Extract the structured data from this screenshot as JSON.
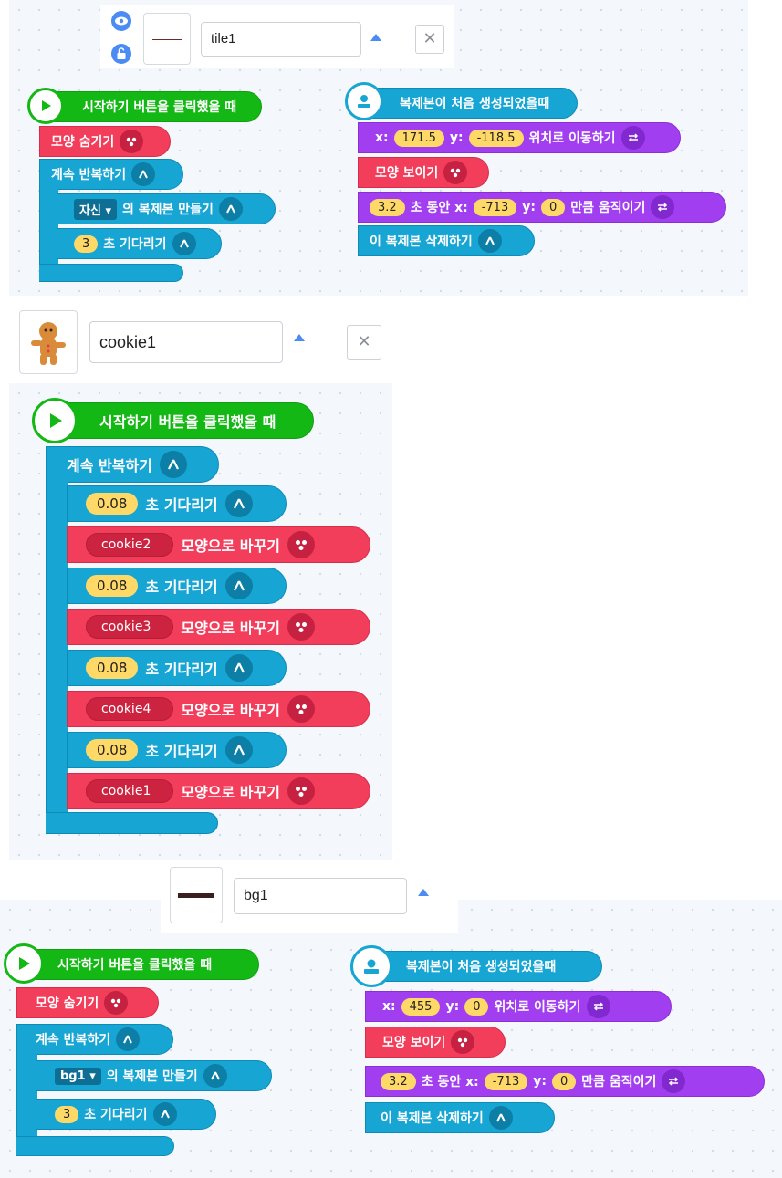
{
  "colors": {
    "cyan": "#17a5d3",
    "red": "#f23d5b",
    "purple": "#a13ef0",
    "green": "#14b814",
    "value": "#ffd968",
    "accent": "#4a8cf4"
  },
  "icons": {
    "eye": "eye-icon",
    "lock": "lock-icon",
    "close": "close-icon",
    "play": "play-icon",
    "user": "user-icon",
    "flow": "flow-icon",
    "shape": "shape-icon",
    "move": "move-icon"
  },
  "objects": [
    {
      "name": "tile1",
      "close": "✕"
    },
    {
      "name": "cookie1",
      "close": "✕"
    },
    {
      "name": "bg1"
    }
  ],
  "tile1": {
    "start": "시작하기 버튼을 클릭했을 때",
    "hide": "모양 숨기기",
    "loop": "계속 반복하기",
    "clone_target": "자신",
    "clone_label": "의 복제본 만들기",
    "wait_val": "3",
    "wait_label": "초 기다리기",
    "clone_start": "복제본이 처음 생성되었을때",
    "x_label": "x:",
    "x_val": "171.5",
    "y_label": "y:",
    "y_val": "-118.5",
    "move_to": "위치로 이동하기",
    "show": "모양 보이기",
    "dur": "3.2",
    "dur_label": "초 동안 x:",
    "dx": "-713",
    "dy_label": "y:",
    "dy": "0",
    "move_by": "만큼 움직이기",
    "delete": "이 복제본 삭제하기"
  },
  "cookie1": {
    "start": "시작하기 버튼을 클릭했을 때",
    "loop": "계속 반복하기",
    "wait_label": "초 기다리기",
    "change_label": "모양으로 바꾸기",
    "steps": [
      {
        "wait": "0.08",
        "shape": "cookie2"
      },
      {
        "wait": "0.08",
        "shape": "cookie3"
      },
      {
        "wait": "0.08",
        "shape": "cookie4"
      },
      {
        "wait": "0.08",
        "shape": "cookie1"
      }
    ]
  },
  "bg1": {
    "start": "시작하기 버튼을 클릭했을 때",
    "hide": "모양 숨기기",
    "loop": "계속 반복하기",
    "clone_target": "bg1",
    "clone_label": "의 복제본 만들기",
    "wait_val": "3",
    "wait_label": "초 기다리기",
    "clone_start": "복제본이 처음 생성되었을때",
    "x_label": "x:",
    "x_val": "455",
    "y_label": "y:",
    "y_val": "0",
    "move_to": "위치로 이동하기",
    "show": "모양 보이기",
    "dur": "3.2",
    "dur_label": "초 동안 x:",
    "dx": "-713",
    "dy_label": "y:",
    "dy": "0",
    "move_by": "만큼 움직이기",
    "delete": "이 복제본 삭제하기"
  }
}
